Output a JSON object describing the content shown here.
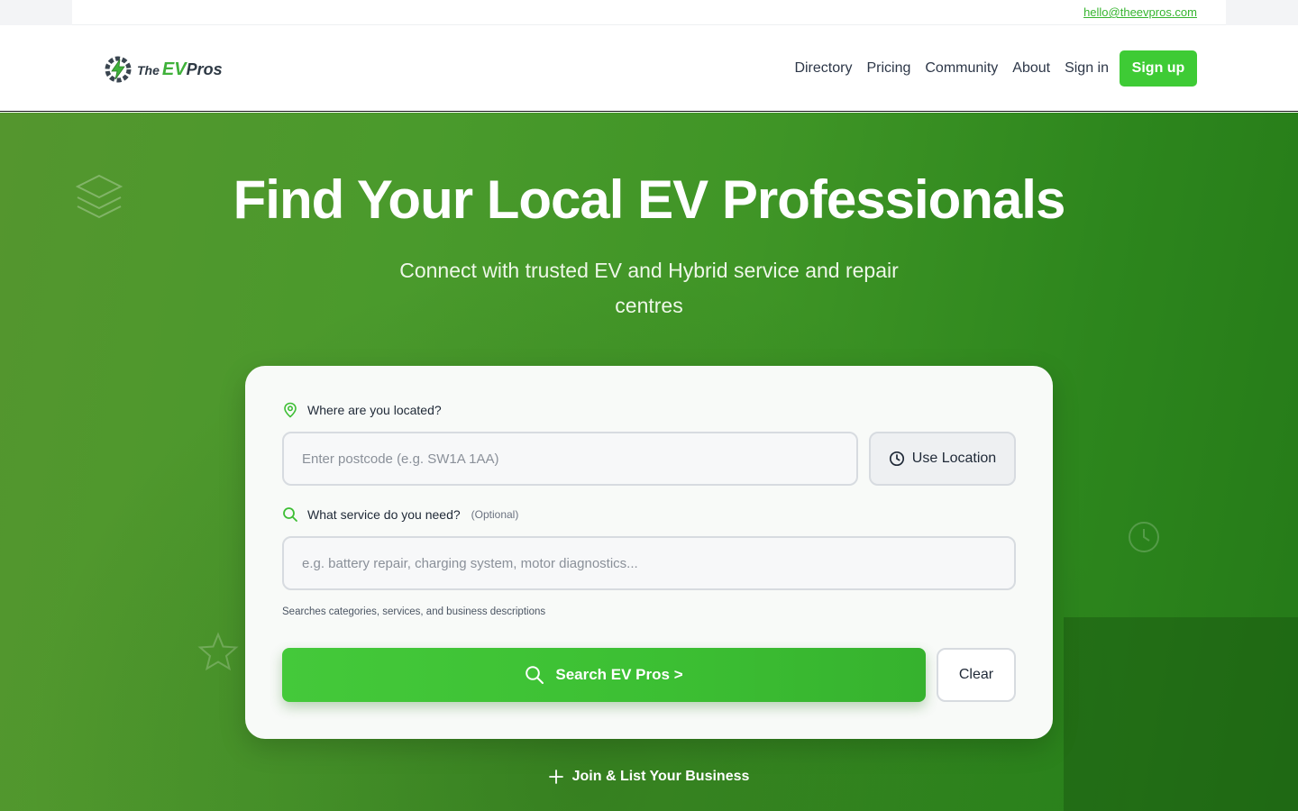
{
  "topbar": {
    "email": "hello@theevpros.com"
  },
  "brand": {
    "the": "The",
    "ev": "EV",
    "pros": "Pros"
  },
  "nav": {
    "items": [
      {
        "label": "Directory"
      },
      {
        "label": "Pricing"
      },
      {
        "label": "Community"
      },
      {
        "label": "About"
      },
      {
        "label": "Sign in"
      }
    ],
    "signup_label": "Sign up"
  },
  "hero": {
    "title": "Find Your Local EV Professionals",
    "subtitle": "Connect with trusted EV and Hybrid service and repair centres"
  },
  "search_form": {
    "location_label": "Where are you located?",
    "postcode_placeholder": "Enter postcode (e.g. SW1A 1AA)",
    "postcode_value": "",
    "use_location_label": "Use Location",
    "service_label": "What service do you need?",
    "service_optional": "(Optional)",
    "service_placeholder": "e.g. battery repair, charging system, motor diagnostics...",
    "service_value": "",
    "helper_text": "Searches categories, services, and business descriptions",
    "search_label": "Search EV Pros >",
    "clear_label": "Clear"
  },
  "join_label": "Join & List Your Business",
  "colors": {
    "accent": "#3ecb35",
    "hero_green": "#3f9526",
    "text_dark": "#2d3748"
  },
  "icons": {
    "logo": "gear-bolt-icon",
    "location": "map-pin-icon",
    "use_location": "clock-icon",
    "service": "search-icon",
    "search_button": "search-icon",
    "join": "plus-icon"
  }
}
